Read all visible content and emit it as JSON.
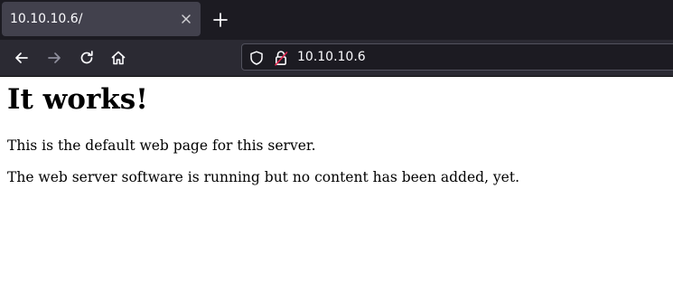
{
  "browser": {
    "tab": {
      "title": "10.10.10.6/"
    },
    "address_bar": {
      "url": "10.10.10.6"
    },
    "icons": {
      "tab_close": "close-icon",
      "new_tab": "plus-icon",
      "back": "arrow-left-icon",
      "forward": "arrow-right-icon",
      "reload": "reload-icon",
      "home": "home-icon",
      "tracking_protection": "shield-icon",
      "insecure_connection": "lock-insecure-icon"
    },
    "colors": {
      "tabstrip_bg": "#1c1b22",
      "active_tab_bg": "#42414d",
      "toolbar_bg": "#2b2a33",
      "urlbar_bg": "#1c1b22",
      "insecure_lock_accent": "#e22850"
    }
  },
  "page": {
    "heading": "It works!",
    "paragraphs": [
      "This is the default web page for this server.",
      "The web server software is running but no content has been added, yet."
    ]
  }
}
